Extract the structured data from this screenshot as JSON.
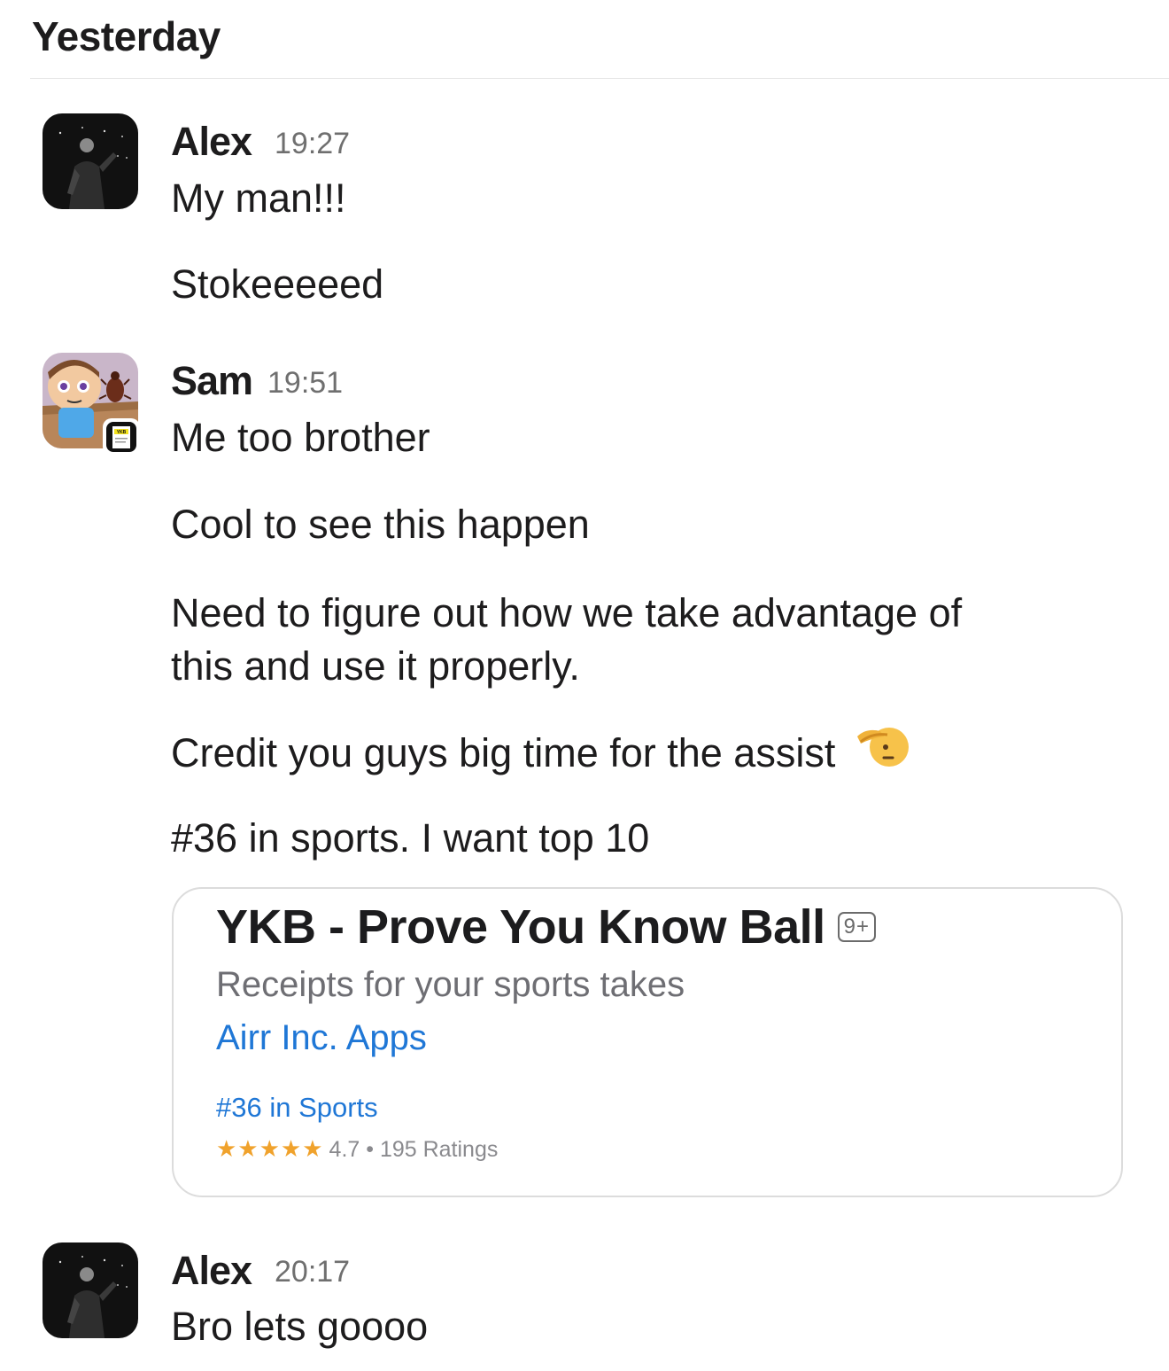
{
  "date_header": "Yesterday",
  "messages": [
    {
      "author": "Alex",
      "time": "19:27",
      "lines": [
        "My man!!!",
        "Stokeeeeed"
      ]
    },
    {
      "author": "Sam",
      "time": "19:51",
      "lines": [
        "Me too brother",
        "Cool to see this happen",
        "Need to figure out how we take advantage of",
        "this and use it properly.",
        "Credit you guys big time for the assist",
        "#36 in sports. I want top 10"
      ],
      "emoji": "saluting-face-icon",
      "link_card": {
        "title": "YKB - Prove You Know Ball",
        "age_rating": "9+",
        "subtitle": "Receipts for your sports takes",
        "developer": "Airr Inc. Apps",
        "rank": "#36 in Sports",
        "stars": "★★★★★",
        "rating": "4.7 • 195 Ratings",
        "star_value": 4.7
      },
      "avatar_badge": "YKB"
    },
    {
      "author": "Alex",
      "time": "20:17",
      "lines": [
        "Bro lets goooo"
      ]
    }
  ],
  "colors": {
    "text": "#1d1c1d",
    "timestamp": "#6f6f6f",
    "link_blue": "#1f77d6",
    "star_orange": "#f0a22c",
    "card_border": "#dcdcdc"
  }
}
